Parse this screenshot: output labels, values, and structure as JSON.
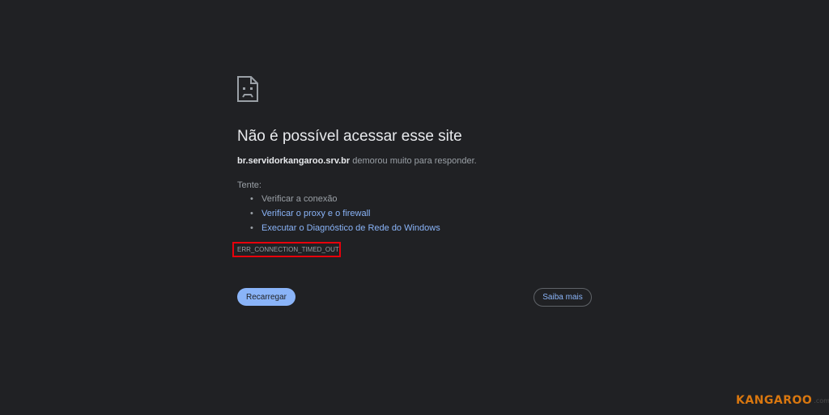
{
  "page": {
    "icon": "sad-document-icon",
    "title": "Não é possível acessar esse site",
    "summary": {
      "host": "br.servidorkangaroo.srv.br",
      "message": " demorou muito para responder."
    },
    "try_label": "Tente:",
    "suggestions": [
      {
        "label": "Verificar a conexão",
        "is_link": false
      },
      {
        "label": "Verificar o proxy e o firewall",
        "is_link": true
      },
      {
        "label": "Executar o Diagnóstico de Rede do Windows",
        "is_link": true
      }
    ],
    "error_code": "ERR_CONNECTION_TIMED_OUT",
    "reload_label": "Recarregar",
    "details_label": "Saiba mais"
  },
  "watermark": {
    "brand": "KANGAROO",
    "tld": ".com"
  },
  "colors": {
    "background": "#202124",
    "accent": "#8ab4f8",
    "highlight_box": "#e8000b",
    "brand": "#d9770f"
  }
}
